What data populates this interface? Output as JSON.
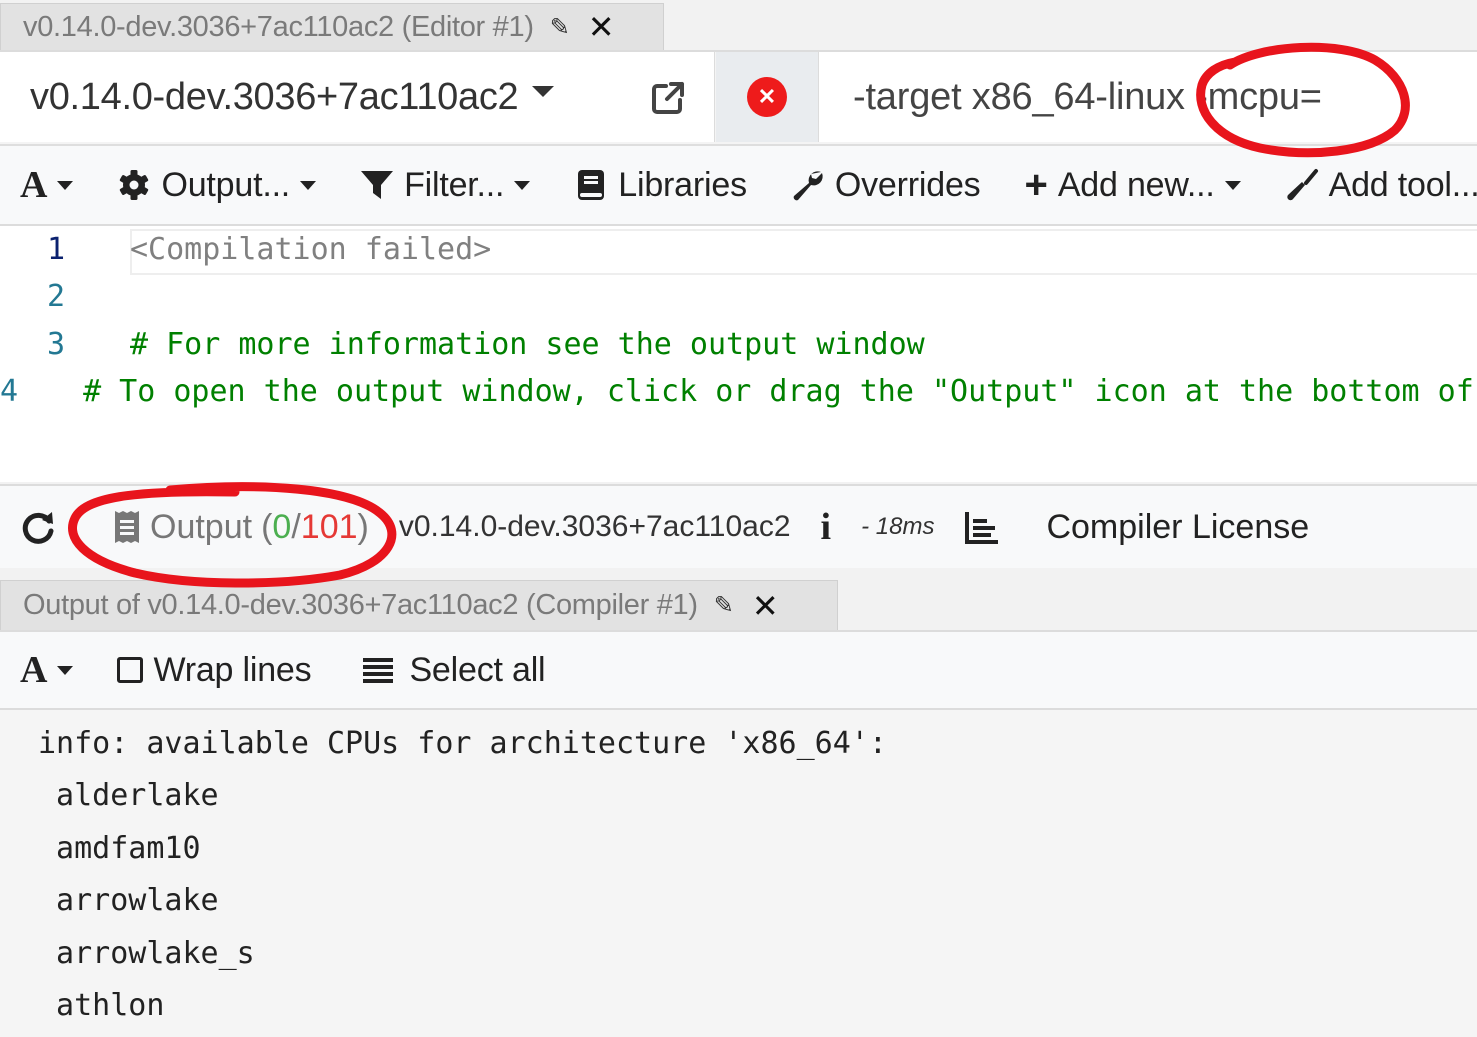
{
  "editor_tab": {
    "title": "v0.14.0-dev.3036+7ac110ac2 (Editor #1)",
    "rename_icon": "pencil-icon",
    "close_icon": "close-icon"
  },
  "compiler": {
    "selected": "v0.14.0-dev.3036+7ac110ac2",
    "popout_icon": "external-link-icon",
    "error_icon": "error-circle-icon",
    "options_value": "-target x86_64-linux -mcpu="
  },
  "toolbar": {
    "font_label": "A",
    "output_label": "Output...",
    "filter_label": "Filter...",
    "libraries_label": "Libraries",
    "overrides_label": "Overrides",
    "add_new_label": "Add new...",
    "add_tool_label": "Add tool..."
  },
  "code": {
    "lines": [
      {
        "num": "1",
        "text": "<Compilation failed>"
      },
      {
        "num": "2",
        "text": ""
      },
      {
        "num": "3",
        "text": "# For more information see the output window"
      },
      {
        "num": "4",
        "text": "# To open the output window, click or drag the \"Output\" icon at the bottom of this window"
      }
    ]
  },
  "status": {
    "output_label": "Output",
    "output_ok": "0",
    "output_total": "101",
    "compiler_version": "v0.14.0-dev.3036+7ac110ac2",
    "info_label": "i",
    "time": "- 18ms",
    "license_label": "Compiler License"
  },
  "output_tab": {
    "title": "Output of v0.14.0-dev.3036+7ac110ac2 (Compiler #1)"
  },
  "output_toolbar": {
    "font_label": "A",
    "wrap_label": "Wrap lines",
    "wrap_checked": false,
    "select_all_label": "Select all"
  },
  "output": {
    "lines": [
      "info: available CPUs for architecture 'x86_64':",
      " alderlake",
      " amdfam10",
      " arrowlake",
      " arrowlake_s",
      " athlon"
    ]
  },
  "colors": {
    "error": "#ee1b1b",
    "ok_count": "#4caf50",
    "fail_count": "#e53935",
    "comment": "#008000",
    "annotation": "#e8141c"
  }
}
